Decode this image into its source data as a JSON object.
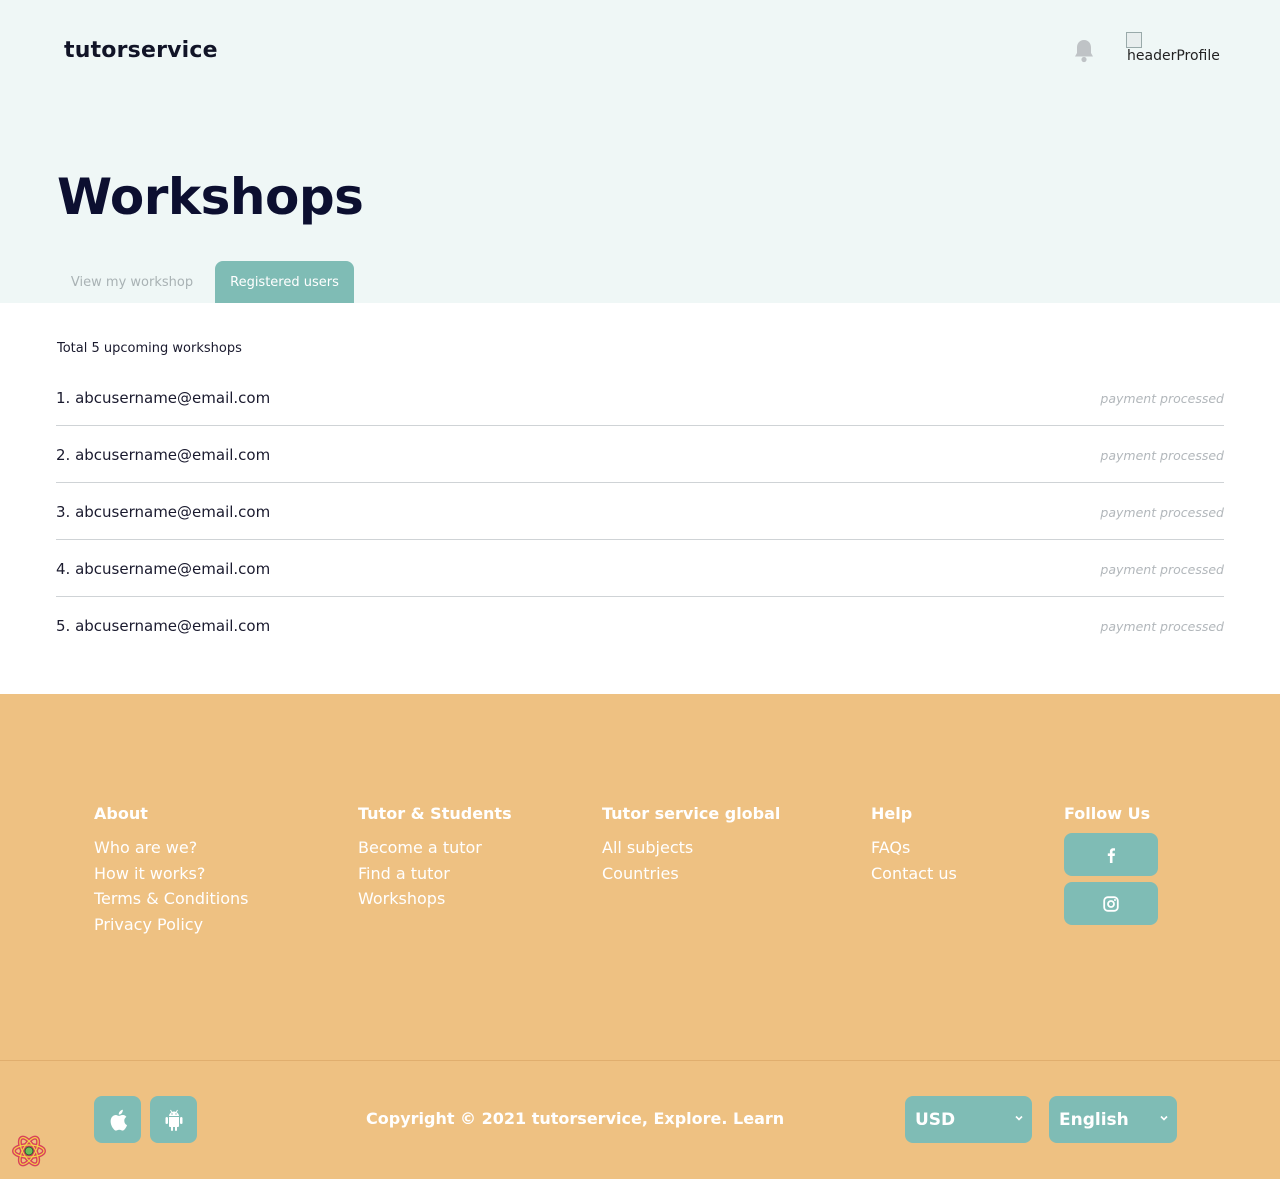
{
  "header": {
    "brand": "tutorservice",
    "profile_alt": "headerProfile"
  },
  "page": {
    "title": "Workshops",
    "tabs": [
      {
        "label": "View my workshop",
        "active": false
      },
      {
        "label": "Registered users",
        "active": true
      }
    ],
    "total_text": "Total 5 upcoming workshops"
  },
  "registrations": [
    {
      "email": "1. abcusername@email.com",
      "status": "payment processed"
    },
    {
      "email": "2. abcusername@email.com",
      "status": "payment processed"
    },
    {
      "email": "3. abcusername@email.com",
      "status": "payment processed"
    },
    {
      "email": "4. abcusername@email.com",
      "status": "payment processed"
    },
    {
      "email": "5. abcusername@email.com",
      "status": "payment processed"
    }
  ],
  "footer": {
    "about": {
      "heading": "About",
      "links": [
        "Who are we?",
        "How it works?",
        "Terms & Conditions",
        "Privacy Policy"
      ]
    },
    "tutor_students": {
      "heading": "Tutor & Students",
      "links": [
        "Become a tutor",
        "Find a tutor",
        "Workshops"
      ]
    },
    "global": {
      "heading": "Tutor service global",
      "links": [
        "All subjects",
        "Countries"
      ]
    },
    "help": {
      "heading": "Help",
      "links": [
        "FAQs",
        "Contact us"
      ]
    },
    "follow": {
      "heading": "Follow Us",
      "social": [
        "facebook-icon",
        "instagram-icon"
      ]
    },
    "copyright": "Copyright © 2021 tutorservice, Explore. Learn",
    "currency": "USD",
    "language": "English",
    "apps": [
      "apple-icon",
      "android-icon"
    ]
  },
  "colors": {
    "hero_bg": "#eff7f6",
    "accent_teal": "#7fbcb5",
    "footer_bg": "#eec182",
    "title": "#0c0f30"
  }
}
